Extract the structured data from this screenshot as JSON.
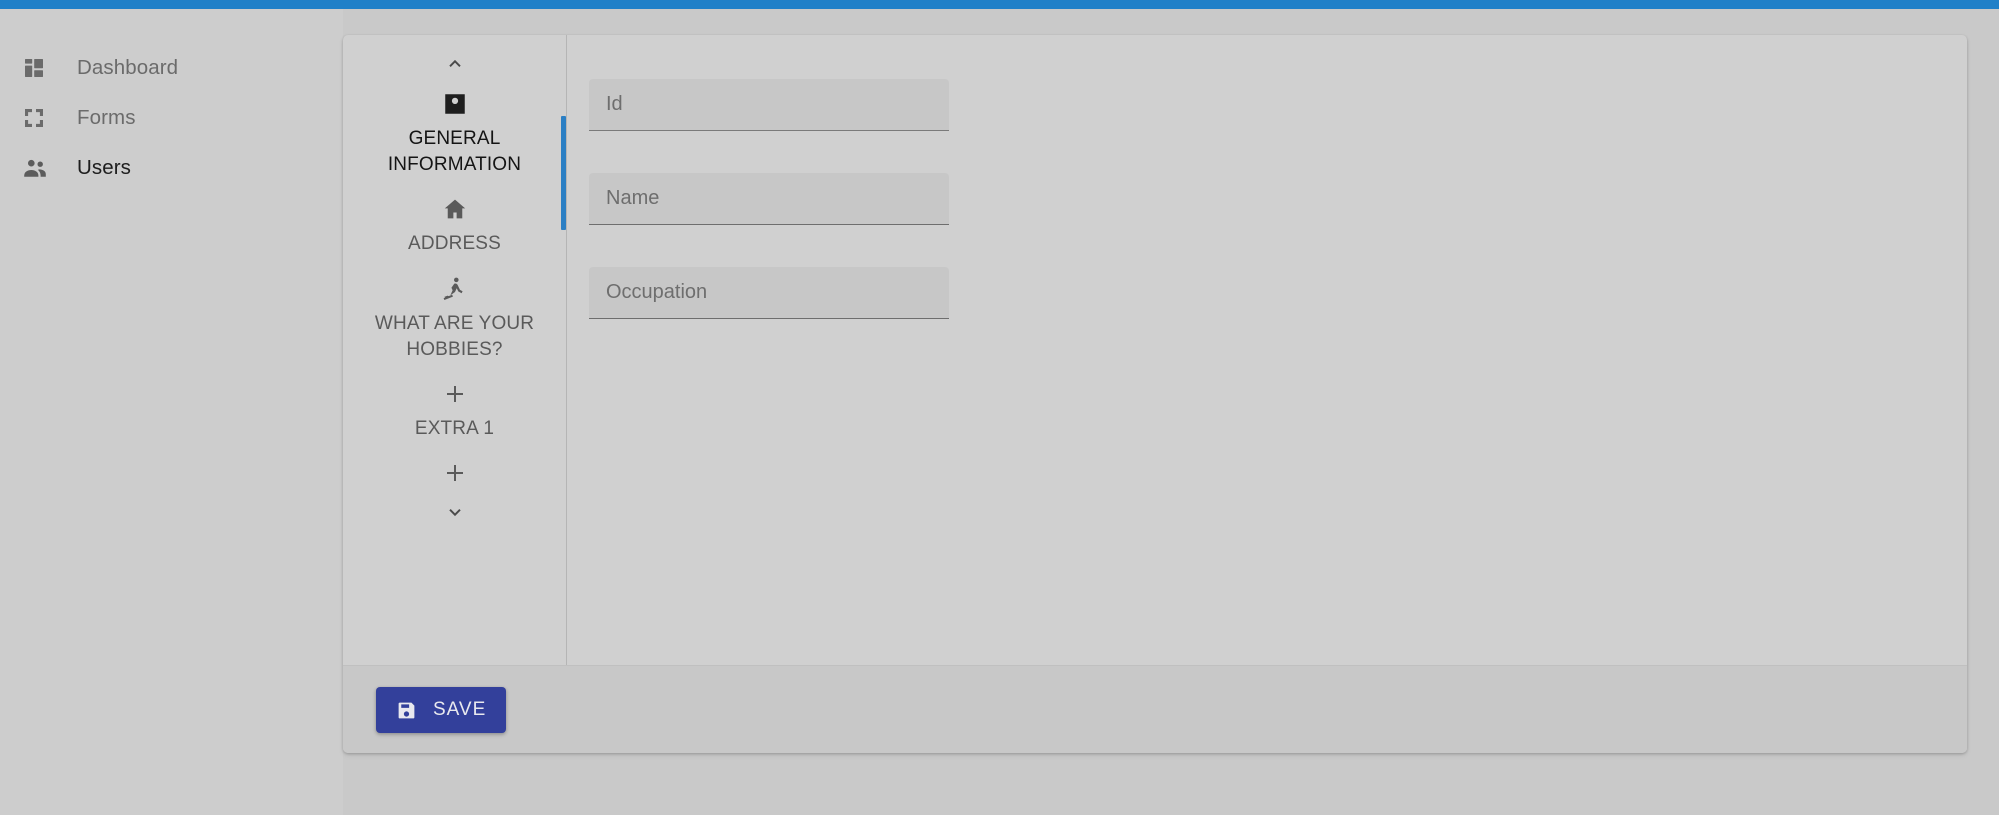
{
  "theme": {
    "accent_bar": "#2080c8",
    "page_background": "#c9c9c9",
    "card_background": "#d0d0d0",
    "step_active_indicator": "#2b7fc4",
    "save_button": "#33409b"
  },
  "sidebar": {
    "items": [
      {
        "label": "Dashboard",
        "icon": "dashboard-icon",
        "active": false
      },
      {
        "label": "Forms",
        "icon": "forms-icon",
        "active": false
      },
      {
        "label": "Users",
        "icon": "users-icon",
        "active": true
      }
    ]
  },
  "stepper": {
    "scroll_up_icon": "chevron-up-icon",
    "scroll_down_icon": "chevron-down-icon",
    "steps": [
      {
        "label": "GENERAL INFORMATION",
        "icon": "account-box-icon",
        "active": true
      },
      {
        "label": "ADDRESS",
        "icon": "home-icon",
        "active": false
      },
      {
        "label": "WHAT ARE YOUR HOBBIES?",
        "icon": "rowing-icon",
        "active": false
      },
      {
        "label": "EXTRA 1",
        "icon": "plus-icon",
        "active": false
      },
      {
        "label": "",
        "icon": "plus-icon",
        "active": false
      }
    ]
  },
  "form": {
    "fields": [
      {
        "name": "id",
        "placeholder": "Id",
        "value": "",
        "focused": true
      },
      {
        "name": "name",
        "placeholder": "Name",
        "value": "",
        "focused": false
      },
      {
        "name": "occupation",
        "placeholder": "Occupation",
        "value": "",
        "focused": false
      }
    ]
  },
  "footer": {
    "save_label": "SAVE",
    "save_icon": "save-floppy-icon"
  }
}
